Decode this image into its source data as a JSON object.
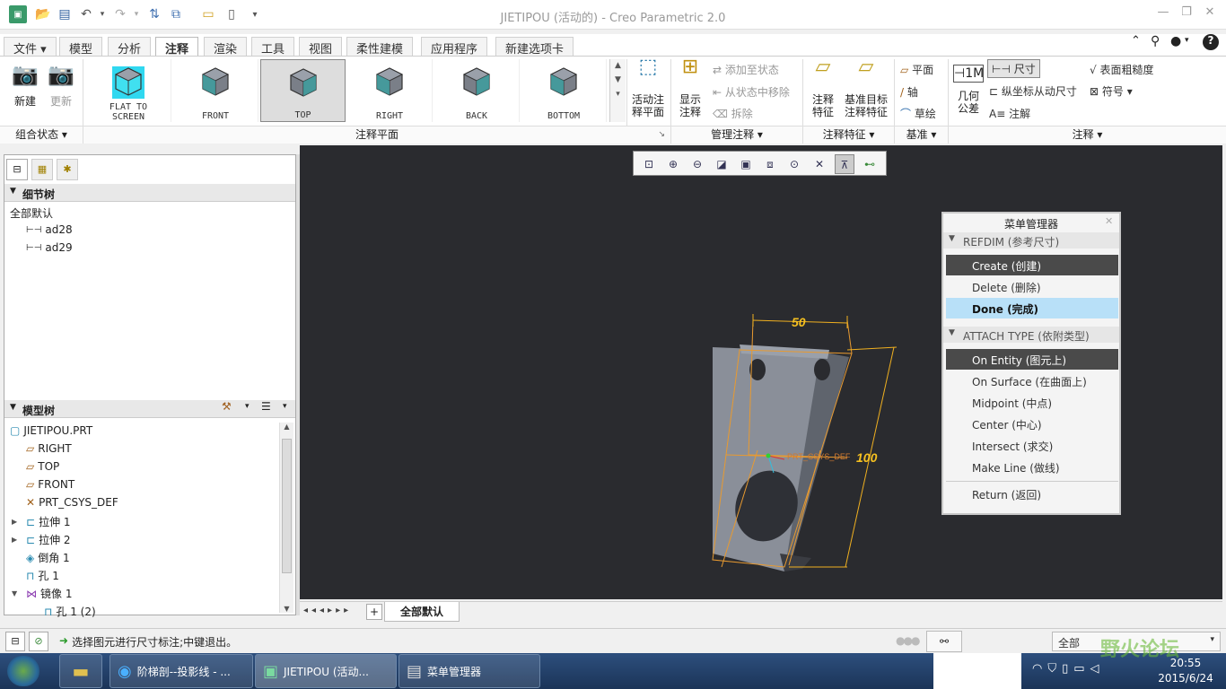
{
  "window": {
    "title": "JIETIPOU (活动的) - Creo Parametric 2.0"
  },
  "tabs": [
    "文件",
    "模型",
    "分析",
    "注释",
    "渲染",
    "工具",
    "视图",
    "柔性建模",
    "应用程序",
    "新建选项卡"
  ],
  "active_tab": "注释",
  "ribbon": {
    "new": "新建",
    "update": "更新",
    "views": [
      "FLAT TO SCREEN",
      "FRONT",
      "TOP",
      "RIGHT",
      "BACK",
      "BOTTOM"
    ],
    "selected_view": "TOP",
    "active_plane_1": "活动注",
    "active_plane_2": "释平面",
    "show_1": "显示",
    "show_2": "注释",
    "add_state": "添加至状态",
    "remove_state": "从状态中移除",
    "erase": "拆除",
    "ann_feature_1": "注释",
    "ann_feature_2": "特征",
    "datum_target_1": "基准目标",
    "datum_target_2": "注释特征",
    "plane": "平面",
    "axis": "轴",
    "sketch": "草绘",
    "geom_tol_1": "几何",
    "geom_tol_2": "公差",
    "dimension": "尺寸",
    "ordinate": "纵坐标从动尺寸",
    "note": "注解",
    "roughness": "表面粗糙度",
    "symbol": "符号",
    "groups": [
      "组合状态",
      "注释平面",
      "管理注释",
      "注释特征",
      "基准",
      "注释"
    ]
  },
  "detail_tree": {
    "title": "细节树",
    "root": "全部默认",
    "items": [
      "ad28",
      "ad29"
    ]
  },
  "model_tree": {
    "title": "模型树",
    "items": [
      "JIETIPOU.PRT",
      "RIGHT",
      "TOP",
      "FRONT",
      "PRT_CSYS_DEF",
      "拉伸 1",
      "拉伸 2",
      "倒角 1",
      "孔 1",
      "镜像 1",
      "孔 1 (2)"
    ]
  },
  "viewport": {
    "dim_width": "50",
    "dim_height": "100",
    "csys_label": "PRT_CSYS_DEF"
  },
  "menu_manager": {
    "title": "菜单管理器",
    "sections": [
      {
        "header": "REFDIM (参考尺寸)",
        "items": [
          "Create (创建)",
          "Delete (删除)",
          "Done (完成)"
        ]
      },
      {
        "header": "ATTACH TYPE (依附类型)",
        "items": [
          "On Entity (图元上)",
          "On Surface (在曲面上)",
          "Midpoint (中点)",
          "Center (中心)",
          "Intersect (求交)",
          "Make Line (做线)"
        ]
      }
    ],
    "return": "Return (返回)"
  },
  "bottom_tab": "全部默认",
  "status": {
    "message": "选择图元进行尺寸标注;中键退出。",
    "filter": "全部"
  },
  "taskbar": {
    "items": [
      "阶梯剖--投影线 - ...",
      "JIETIPOU (活动...",
      "菜单管理器"
    ],
    "time": "20:55",
    "date": "2015/6/24",
    "watermark": "野火论坛"
  }
}
